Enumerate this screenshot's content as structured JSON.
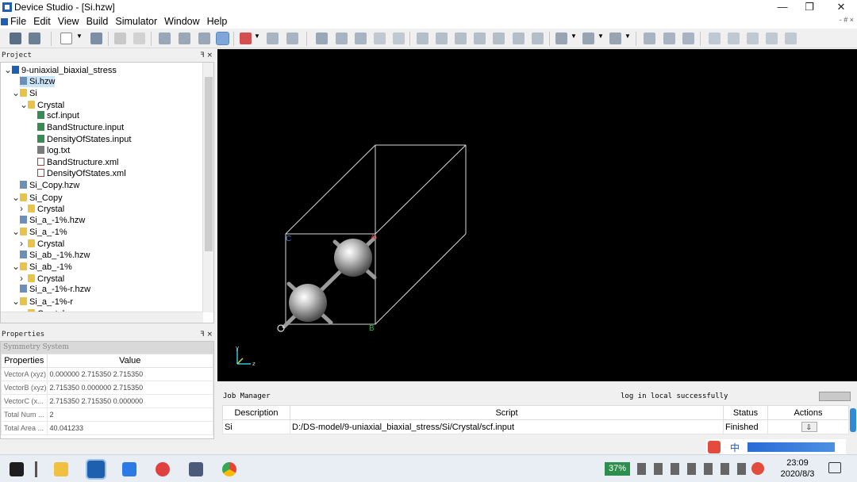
{
  "window": {
    "title": "Device Studio - [Si.hzw]",
    "minimize": "—",
    "restore": "❐",
    "close": "✕",
    "mdi_controls": "- # ×"
  },
  "menu": [
    "File",
    "Edit",
    "View",
    "Build",
    "Simulator",
    "Window",
    "Help"
  ],
  "project_panel": {
    "title": "Project",
    "dock_buttons": "ꟻ ×",
    "tree": [
      {
        "label": "9-uniaxial_biaxial_stress",
        "icon": "project-icon",
        "arrow": "v"
      },
      {
        "label": "Si.hzw",
        "icon": "hzw-file-icon",
        "selected": true
      },
      {
        "label": "Si",
        "icon": "folder-icon",
        "arrow": "v"
      },
      {
        "label": "Crystal",
        "icon": "folder-icon",
        "arrow": "v"
      },
      {
        "label": "scf.input",
        "icon": "input-file-icon"
      },
      {
        "label": "BandStructure.input",
        "icon": "input-file-icon"
      },
      {
        "label": "DensityOfStates.input",
        "icon": "input-file-icon"
      },
      {
        "label": "log.txt",
        "icon": "text-file-icon"
      },
      {
        "label": "BandStructure.xml",
        "icon": "xml-file-icon"
      },
      {
        "label": "DensityOfStates.xml",
        "icon": "xml-file-icon"
      },
      {
        "label": "Si_Copy.hzw",
        "icon": "hzw-file-icon"
      },
      {
        "label": "Si_Copy",
        "icon": "folder-icon",
        "arrow": "v"
      },
      {
        "label": "Crystal",
        "icon": "folder-icon",
        "arrow": ">"
      },
      {
        "label": "Si_a_-1%.hzw",
        "icon": "hzw-file-icon"
      },
      {
        "label": "Si_a_-1%",
        "icon": "folder-icon",
        "arrow": "v"
      },
      {
        "label": "Crystal",
        "icon": "folder-icon",
        "arrow": ">"
      },
      {
        "label": "Si_ab_-1%.hzw",
        "icon": "hzw-file-icon"
      },
      {
        "label": "Si_ab_-1%",
        "icon": "folder-icon",
        "arrow": "v"
      },
      {
        "label": "Crystal",
        "icon": "folder-icon",
        "arrow": ">"
      },
      {
        "label": "Si_a_-1%-r.hzw",
        "icon": "hzw-file-icon"
      },
      {
        "label": "Si_a_-1%-r",
        "icon": "folder-icon",
        "arrow": "v"
      },
      {
        "label": "Crystal",
        "icon": "folder-icon",
        "arrow": ">"
      }
    ]
  },
  "properties_panel": {
    "title": "Properties",
    "dock_buttons": "ꟻ ×",
    "symmetry": "Symmetry System",
    "headers": [
      "Properties",
      "Value"
    ],
    "rows": [
      [
        "VectorA (xyz)",
        "0.000000 2.715350 2.715350"
      ],
      [
        "VectorB (xyz)",
        "2.715350 0.000000 2.715350"
      ],
      [
        "VectorC (x...",
        "2.715350 2.715350 0.000000"
      ],
      [
        "Total Num ...",
        "2"
      ],
      [
        "Total Area ...",
        "40.041233"
      ]
    ]
  },
  "viewport": {
    "axis_labels": {
      "a": "A",
      "b": "B",
      "c": "C",
      "y": "y",
      "z": "z"
    }
  },
  "job_manager": {
    "title": "Job Manager",
    "message": "log in local successfully",
    "headers": [
      "Description",
      "Script",
      "Status",
      "Actions"
    ],
    "rows": [
      {
        "description": "Si",
        "script": "D:/DS-model/9-uniaxial_biaxial_stress/Si/Crystal/scf.input",
        "status": "Finished",
        "action": "⇩"
      }
    ]
  },
  "taskbar": {
    "battery": "37%",
    "time": "23:09",
    "date": "2020/8/3",
    "ime": "中"
  }
}
